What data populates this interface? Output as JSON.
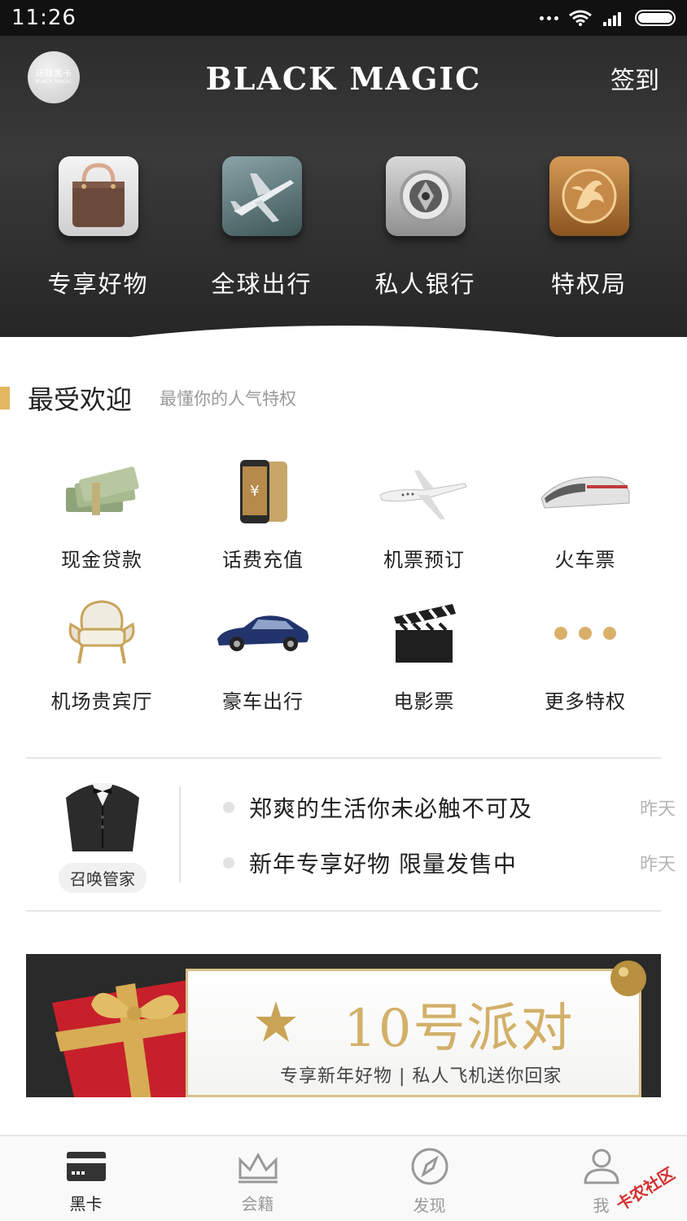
{
  "status_bar": {
    "time": "11:26"
  },
  "header": {
    "avatar_text": "环球黑卡",
    "avatar_subtext": "BLACK MAGIC",
    "brand": "BLACK MAGIC",
    "checkin_label": "签到"
  },
  "categories": [
    {
      "label": "专享好物",
      "icon": "handbag-icon"
    },
    {
      "label": "全球出行",
      "icon": "airplane-icon"
    },
    {
      "label": "私人银行",
      "icon": "vault-icon"
    },
    {
      "label": "特权局",
      "icon": "dragon-emblem-icon"
    }
  ],
  "popular": {
    "title": "最受欢迎",
    "subtitle": "最懂你的人气特权",
    "items": [
      {
        "label": "现金贷款",
        "icon": "cash-icon"
      },
      {
        "label": "话费充值",
        "icon": "phone-icon"
      },
      {
        "label": "机票预订",
        "icon": "jet-icon"
      },
      {
        "label": "火车票",
        "icon": "train-icon"
      },
      {
        "label": "机场贵宾厅",
        "icon": "armchair-icon"
      },
      {
        "label": "豪车出行",
        "icon": "car-icon"
      },
      {
        "label": "电影票",
        "icon": "clapperboard-icon"
      },
      {
        "label": "更多特权",
        "icon": "more-dots-icon"
      }
    ]
  },
  "butler": {
    "label": "召唤管家",
    "icon": "tuxedo-icon"
  },
  "news": [
    {
      "text": "郑爽的生活你未必触不可及",
      "time": "昨天"
    },
    {
      "text": "新年专享好物 限量发售中",
      "time": "昨天"
    }
  ],
  "banner": {
    "title": "10号派对",
    "subtitle": "专享新年好物 | 私人飞机送你回家"
  },
  "tabs": [
    {
      "label": "黑卡",
      "icon": "card-icon",
      "active": true
    },
    {
      "label": "会籍",
      "icon": "crown-icon",
      "active": false
    },
    {
      "label": "发现",
      "icon": "compass-icon",
      "active": false
    },
    {
      "label": "我",
      "icon": "user-icon",
      "active": false
    }
  ],
  "watermark": "卡农社区",
  "colors": {
    "accent_gold": "#e2b661",
    "hero_dark": "#2c2c2c"
  }
}
